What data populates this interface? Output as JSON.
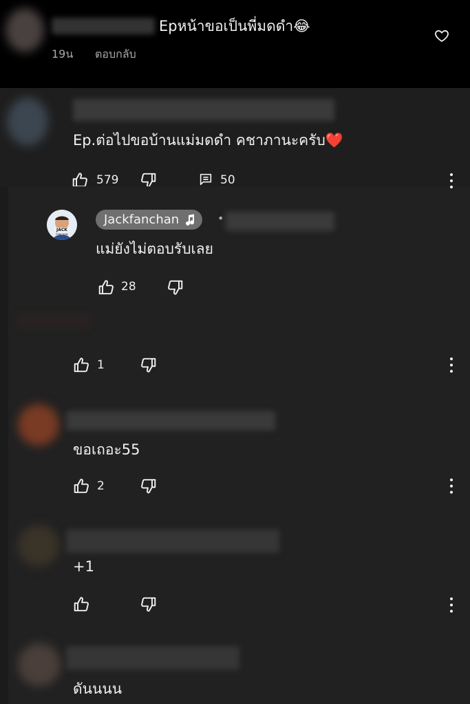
{
  "top_comment": {
    "text": "Epหน้าขอเป็นพี่มดดำ😂",
    "age": "19น",
    "reply_label": "ตอบกลับ"
  },
  "comment_main": {
    "text": "Ep.ต่อไปขอบ้านแม่มดดำ คชาภานะครับ❤️",
    "likes": "579",
    "replies_count": "50"
  },
  "jack_reply": {
    "username": "Jackfanchan",
    "separator": "•",
    "avatar_text_top": "JACK",
    "avatar_text_bottom": "FANCHAN",
    "text": "แม่ยังไม่ตอบรับเลย",
    "likes": "28"
  },
  "reply_hidden": {
    "likes": "1"
  },
  "reply_khoe": {
    "text": "ขอเถอะ55",
    "likes": "2"
  },
  "reply_plus": {
    "text": "+1"
  },
  "reply_last": {
    "text": "ดันนนน"
  },
  "colors": {
    "background": "#212121",
    "top_background": "#000000",
    "chip": "#6f6f6f",
    "heart": "#e53935"
  },
  "icons": [
    "heart-icon",
    "thumbs-up-icon",
    "thumbs-down-icon",
    "comment-icon",
    "more-vert-icon",
    "music-note-icon"
  ]
}
